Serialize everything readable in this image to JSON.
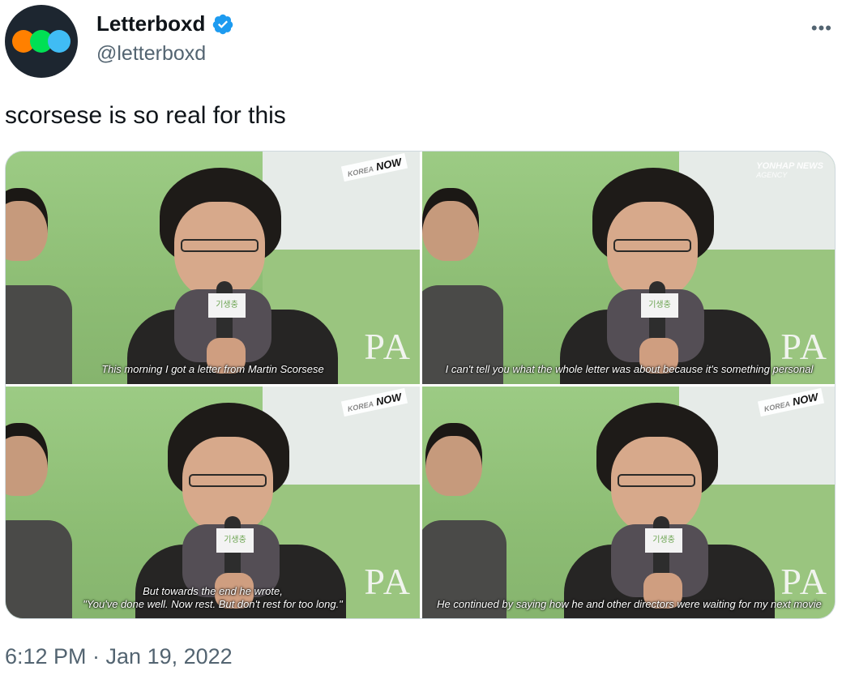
{
  "author": {
    "display_name": "Letterboxd",
    "handle": "@letterboxd",
    "verified": true,
    "avatar_colors": [
      "#ff8000",
      "#00e054",
      "#40bcf4"
    ]
  },
  "more_label": "•••",
  "tweet": {
    "text": "scorsese is so real for this"
  },
  "media": [
    {
      "watermark": "NOW",
      "watermark_prefix": "KOREA",
      "caption_lines": [
        "This morning I got a letter from Martin Scorsese"
      ]
    },
    {
      "watermark": "YONHAP NEWS",
      "watermark_prefix": "AGENCY",
      "caption_lines": [
        "I can't tell you what the whole letter was about because it's something personal"
      ]
    },
    {
      "watermark": "NOW",
      "watermark_prefix": "KOREA",
      "caption_lines": [
        "But towards the end he wrote,",
        "\"You've done well. Now rest. But don't rest for too long.\""
      ]
    },
    {
      "watermark": "NOW",
      "watermark_prefix": "KOREA",
      "caption_lines": [
        "He continued by saying how he and other directors were waiting for my next movie"
      ]
    }
  ],
  "mic_card_text": "기생충",
  "backdrop_text": "PA",
  "timestamp": "6:12 PM · Jan 19, 2022",
  "colors": {
    "verified_blue": "#1d9bf0",
    "secondary_text": "#536471",
    "primary_text": "#0f1419"
  }
}
